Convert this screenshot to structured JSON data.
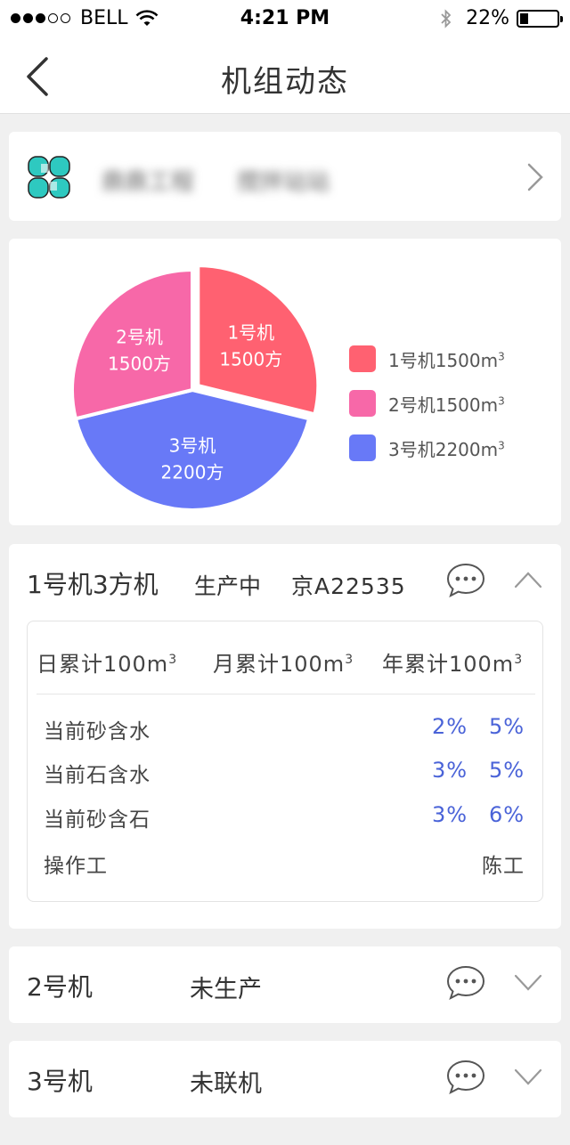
{
  "status_bar": {
    "carrier": "BELL",
    "time": "4:21 PM",
    "battery_percent": "22%",
    "battery_level": 0.22
  },
  "nav": {
    "title": "机组动态"
  },
  "company": {
    "name_blurred_1": "鼎鼎工程",
    "name_blurred_2": "搅拌站站"
  },
  "chart_data": {
    "type": "pie",
    "slices": [
      {
        "name": "1号机",
        "value": 1500,
        "slice_label": "1500方",
        "color": "#ff6171"
      },
      {
        "name": "2号机",
        "value": 1500,
        "slice_label": "1500方",
        "color": "#f768a8"
      },
      {
        "name": "3号机",
        "value": 2200,
        "slice_label": "2200方",
        "color": "#6879f7"
      }
    ],
    "legend": [
      {
        "label": "1号机1500m",
        "sup": "3"
      },
      {
        "label": "2号机1500m",
        "sup": "3"
      },
      {
        "label": "3号机2200m",
        "sup": "3"
      }
    ],
    "legend_placement": "right"
  },
  "machines": [
    {
      "name": "1号机3方机",
      "status": "生产中",
      "plate": "京A22535",
      "expanded": true,
      "stats": [
        {
          "label": "日累计100m",
          "sup": "3"
        },
        {
          "label": "月累计100m",
          "sup": "3"
        },
        {
          "label": "年累计100m",
          "sup": "3"
        }
      ],
      "params": [
        {
          "label": "当前砂含水",
          "v1": "2%",
          "v2": "5%"
        },
        {
          "label": "当前石含水",
          "v1": "3%",
          "v2": "5%"
        },
        {
          "label": "当前砂含石",
          "v1": "3%",
          "v2": "6%"
        }
      ],
      "operator_label": "操作工",
      "operator_value": "陈工"
    },
    {
      "name": "2号机",
      "status": "未生产",
      "expanded": false
    },
    {
      "name": "3号机",
      "status": "未联机",
      "expanded": false
    }
  ]
}
